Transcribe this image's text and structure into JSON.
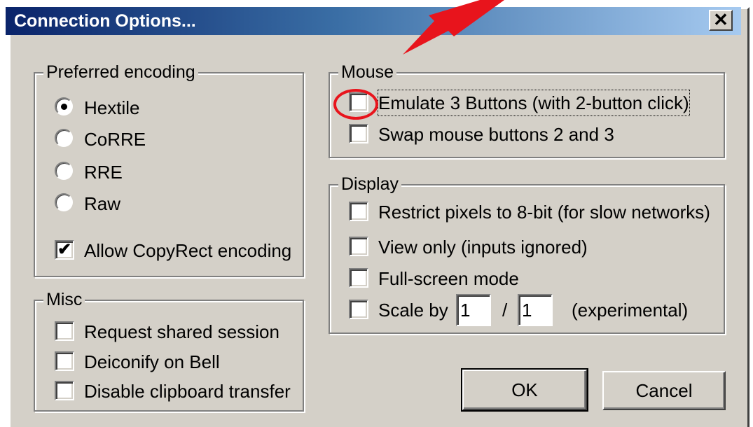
{
  "window": {
    "title": "Connection Options...",
    "close_glyph": "✕"
  },
  "encoding": {
    "legend": "Preferred encoding",
    "options": [
      "Hextile",
      "CoRRE",
      "RRE",
      "Raw"
    ],
    "selected": "Hextile",
    "copyrect_label": "Allow CopyRect encoding",
    "copyrect_checked": true
  },
  "misc": {
    "legend": "Misc",
    "items": [
      "Request shared session",
      "Deiconify on Bell",
      "Disable clipboard transfer"
    ]
  },
  "mouse": {
    "legend": "Mouse",
    "items": [
      "Emulate 3 Buttons (with 2-button click)",
      "Swap mouse buttons 2 and 3"
    ]
  },
  "display": {
    "legend": "Display",
    "items": [
      "Restrict pixels to 8-bit (for slow networks)",
      "View only (inputs ignored)",
      "Full-screen mode"
    ],
    "scale_label": "Scale by",
    "scale_num": "1",
    "scale_sep": "/",
    "scale_den": "1",
    "scale_note": "(experimental)"
  },
  "buttons": {
    "ok": "OK",
    "cancel": "Cancel"
  },
  "annotation": {
    "color": "#e8141c"
  },
  "check_mark": "✔"
}
